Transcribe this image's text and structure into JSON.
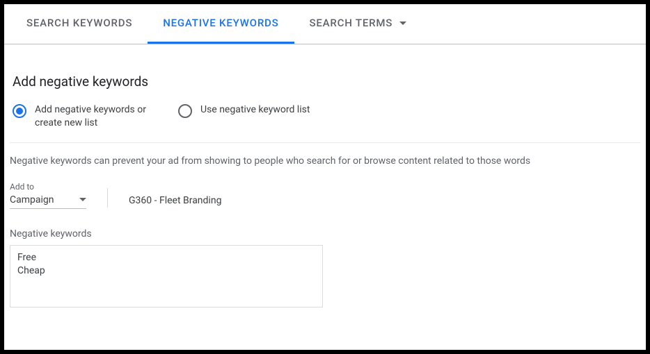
{
  "tabs": {
    "search_keywords": "SEARCH KEYWORDS",
    "negative_keywords": "NEGATIVE KEYWORDS",
    "search_terms": "SEARCH TERMS"
  },
  "page_title": "Add negative keywords",
  "radios": {
    "add_new": "Add negative keywords or create new list",
    "use_list": "Use negative keyword list"
  },
  "help_text": "Negative keywords can prevent your ad from showing to people who search for or browse content related to those words",
  "add_to": {
    "label": "Add to",
    "scope": "Campaign",
    "target": "G360 - Fleet Branding"
  },
  "negative_keywords": {
    "label": "Negative keywords",
    "value": "Free\nCheap"
  }
}
